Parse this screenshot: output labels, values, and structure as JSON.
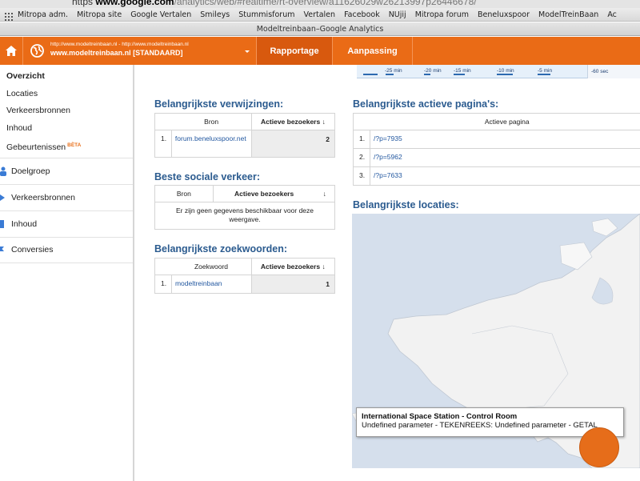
{
  "browser": {
    "url_scheme": "https",
    "url_host": "www.google.com",
    "url_path": "/analytics/web/#realtime/rt-overview/a11626029w26213997p26446678/",
    "bookmarks": [
      "Mitropa adm.",
      "Mitropa site",
      "Google Vertalen",
      "Smileys",
      "Stummisforum",
      "Vertalen",
      "Facebook",
      "NUjij",
      "Mitropa forum",
      "Beneluxspoor",
      "ModelTreinBaan",
      "Ac"
    ],
    "window_title": "Modeltreinbaan–Google Analytics"
  },
  "header": {
    "account_url": "http://www.modeltreinbaan.nl - http://www.modeltreinbaan.nl",
    "account_name": "www.modeltreinbaan.nl [STANDAARD]",
    "tabs": [
      "Rapportage",
      "Aanpassing"
    ]
  },
  "sidebar": {
    "sub_items": [
      {
        "label": "Overzicht",
        "active": true
      },
      {
        "label": "Locaties"
      },
      {
        "label": "Verkeersbronnen"
      },
      {
        "label": "Inhoud"
      },
      {
        "label": "Gebeurtenissen",
        "badge": "BÈTA"
      }
    ],
    "main_items": [
      {
        "label": "Doelgroep",
        "icon": "people-icon"
      },
      {
        "label": "Verkeersbronnen",
        "icon": "traffic-icon"
      },
      {
        "label": "Inhoud",
        "icon": "content-icon"
      },
      {
        "label": "Conversies",
        "icon": "flag-icon"
      }
    ]
  },
  "timeline": {
    "labels": [
      "-25 min",
      "-20 min",
      "-15 min",
      "-10 min",
      "-5 min",
      "-60 sec"
    ]
  },
  "referrals": {
    "title": "Belangrijkste verwijzingen:",
    "col_source": "Bron",
    "col_active": "Actieve bezoekers",
    "sort_arrow": "↓",
    "rows": [
      {
        "num": "1.",
        "source": "forum.beneluxspoor.net",
        "value": "2"
      }
    ]
  },
  "social": {
    "title": "Beste sociale verkeer:",
    "col_source": "Bron",
    "col_active": "Actieve bezoekers",
    "sort_arrow": "↓",
    "empty_message": "Er zijn geen gegevens beschikbaar voor deze weergave."
  },
  "keywords": {
    "title": "Belangrijkste zoekwoorden:",
    "col_keyword": "Zoekwoord",
    "col_active": "Actieve bezoekers",
    "sort_arrow": "↓",
    "rows": [
      {
        "num": "1.",
        "keyword": "modeltreinbaan",
        "value": "1"
      }
    ]
  },
  "pages": {
    "title": "Belangrijkste actieve pagina's:",
    "col_page": "Actieve pagina",
    "rows": [
      {
        "num": "1.",
        "page": "/?p=7935"
      },
      {
        "num": "2.",
        "page": "/?p=5962"
      },
      {
        "num": "3.",
        "page": "/?p=7633"
      }
    ]
  },
  "locations": {
    "title": "Belangrijkste locaties:",
    "tooltip_title": "International Space Station - Control Room",
    "tooltip_detail": "Undefined parameter - TEKENREEKS: Undefined parameter - GETAL"
  },
  "colors": {
    "header_orange": "#ea6b16",
    "active_tab": "#d8590e",
    "title_blue": "#2b5b8f",
    "link_blue": "#2358a0",
    "map_water": "#d5dfec",
    "map_land": "#f2f2f2",
    "marker": "#e66d1a"
  }
}
